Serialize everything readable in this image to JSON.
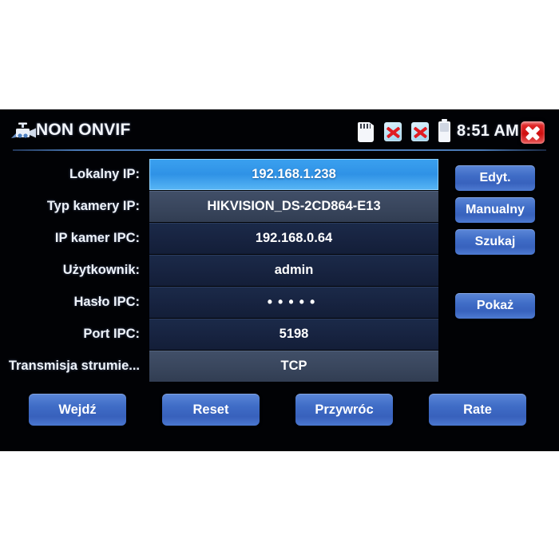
{
  "titlebar": {
    "app_title": "NON ONVIF",
    "camera_icon": "camera-icon",
    "clock": "8:51 AM",
    "status_icons": [
      {
        "name": "sd-card-icon",
        "label": "SD card"
      },
      {
        "name": "network-disconnected-icon-1",
        "label": "Network disconnected"
      },
      {
        "name": "network-disconnected-icon-2",
        "label": "Network disconnected"
      },
      {
        "name": "battery-icon",
        "label": "Battery"
      }
    ],
    "close_icon": "close-icon"
  },
  "form": {
    "rows": [
      {
        "label": "Lokalny IP:",
        "value": "192.168.1.238",
        "tone": "field-selected",
        "name": "local-ip"
      },
      {
        "label": "Typ kamery IP:",
        "value": "HIKVISION_DS-2CD864-E13",
        "tone": "field-mid",
        "name": "ip-camera-type"
      },
      {
        "label": "IP kamer IPC:",
        "value": "192.168.0.64",
        "tone": "field-dark",
        "name": "ipc-camera-ip"
      },
      {
        "label": "Użytkownik:",
        "value": "admin",
        "tone": "field-dark",
        "name": "username"
      },
      {
        "label": "Hasło IPC:",
        "value": "•••••",
        "tone": "field-dark",
        "name": "ipc-password",
        "masked": true
      },
      {
        "label": "Port IPC:",
        "value": "5198",
        "tone": "field-dark",
        "name": "ipc-port"
      },
      {
        "label": "Transmisja strumie...",
        "value": "TCP",
        "tone": "field-mid",
        "name": "stream-transmission"
      }
    ]
  },
  "side_buttons": [
    {
      "label": "Edyt.",
      "name": "edit-button"
    },
    {
      "label": "Manualny",
      "name": "manual-button"
    },
    {
      "label": "Szukaj",
      "name": "search-button"
    },
    {
      "label": "Pokaż",
      "name": "show-button"
    }
  ],
  "bottom_buttons": [
    {
      "label": "Wejdź",
      "name": "enter-button"
    },
    {
      "label": "Reset",
      "name": "reset-button"
    },
    {
      "label": "Przywróc",
      "name": "restore-button"
    },
    {
      "label": "Rate",
      "name": "rate-button"
    }
  ],
  "colors": {
    "panel_background": "#010205",
    "accent_blue": "#3f6cc6",
    "selected_field": "#2f92e6",
    "close_red": "#cf0f0f",
    "page_background": "#ffffff"
  }
}
